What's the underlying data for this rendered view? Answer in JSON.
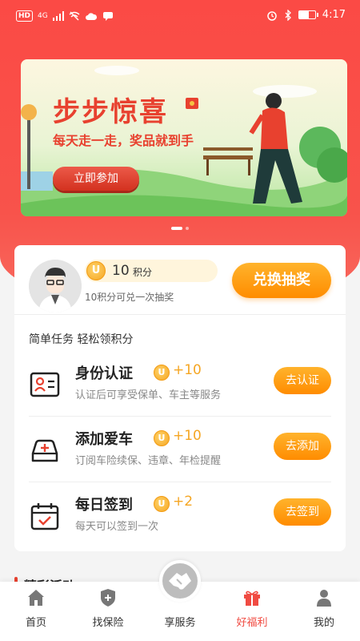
{
  "status_bar": {
    "time": "4:17",
    "network": "4G",
    "hd": "HD",
    "battery_level": 0.6
  },
  "banner": {
    "title": "步步惊喜",
    "subtitle": "每天走一走，奖品就到手",
    "button_label": "立即参加",
    "slide_count": 2,
    "active_slide": 0
  },
  "points": {
    "value": "10",
    "unit": "积分",
    "hint": "10积分可兑一次抽奖",
    "coin_symbol": "U",
    "redeem_label": "兑换抽奖"
  },
  "tasks_section": {
    "title": "简单任务 轻松领积分",
    "tasks": [
      {
        "title": "身份认证",
        "reward": "+10",
        "desc": "认证后可享受保单、车主等服务",
        "button": "去认证",
        "icon": "id-card-icon"
      },
      {
        "title": "添加爱车",
        "reward": "+10",
        "desc": "订阅车险续保、违章、年检提醒",
        "button": "去添加",
        "icon": "car-add-icon"
      },
      {
        "title": "每日签到",
        "reward": "+2",
        "desc": "每天可以签到一次",
        "button": "去签到",
        "icon": "calendar-check-icon"
      }
    ]
  },
  "activity_section": {
    "title": "精彩活动"
  },
  "tab_bar": {
    "items": [
      {
        "label": "首页",
        "icon": "home-icon"
      },
      {
        "label": "找保险",
        "icon": "shield-plus-icon"
      },
      {
        "label": "享服务",
        "icon": "handshake-icon"
      },
      {
        "label": "好福利",
        "icon": "gift-icon",
        "active": true
      },
      {
        "label": "我的",
        "icon": "user-icon"
      }
    ]
  },
  "colors": {
    "primary_red": "#f04b42",
    "orange": "#ff8c00",
    "gold": "#f5a623"
  }
}
